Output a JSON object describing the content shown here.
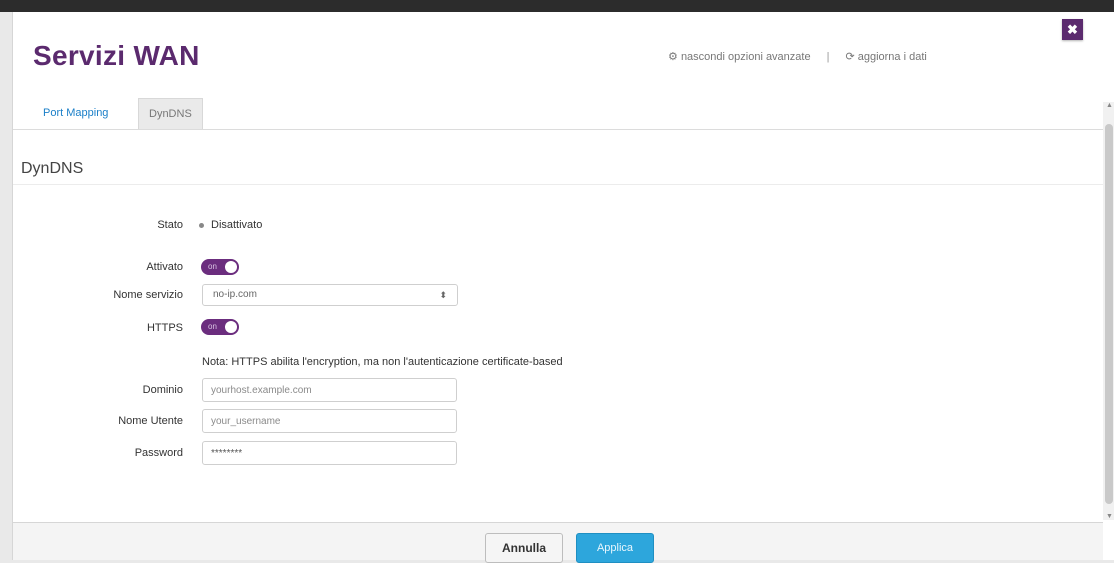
{
  "header": {
    "title": "Servizi WAN",
    "hide_advanced": "nascondi opzioni avanzate",
    "separator": "|",
    "refresh": "aggiorna i dati",
    "close_glyph": "✖"
  },
  "tabs": [
    {
      "label": "Port Mapping",
      "active": true
    },
    {
      "label": "DynDNS",
      "active": false
    }
  ],
  "section": {
    "title": "DynDNS"
  },
  "form": {
    "status_label": "Stato",
    "status_value": "Disattivato",
    "enabled_label": "Attivato",
    "enabled_on": true,
    "toggle_text": "on",
    "service_label": "Nome servizio",
    "service_value": "no-ip.com",
    "https_label": "HTTPS",
    "https_on": true,
    "note": "Nota: HTTPS abilita l'encryption, ma non l'autenticazione certificate-based",
    "domain_label": "Dominio",
    "domain_placeholder": "yourhost.example.com",
    "user_label": "Nome Utente",
    "user_placeholder": "your_username",
    "password_label": "Password",
    "password_value": "********"
  },
  "footer": {
    "cancel": "Annulla",
    "apply": "Applica"
  },
  "icons": {
    "hide": "gear-icon",
    "refresh": "refresh-icon",
    "close": "close-icon",
    "select": "chevron-down-icon"
  },
  "colors": {
    "brand": "#5b2a6e",
    "toggle": "#6b2d7e",
    "accent": "#2da6dc",
    "tab_active": "#1a7fc8"
  }
}
